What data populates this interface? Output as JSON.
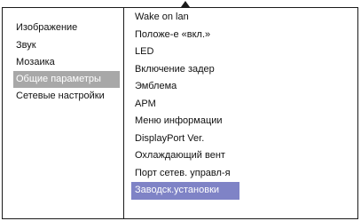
{
  "left_menu": {
    "items": [
      {
        "label": "Изображение"
      },
      {
        "label": "Звук"
      },
      {
        "label": "Мозаика"
      },
      {
        "label": "Общие параметры"
      },
      {
        "label": "Сетевые настройки"
      }
    ],
    "selected_index": 3
  },
  "right_menu": {
    "items": [
      {
        "label": "Wake on lan"
      },
      {
        "label": "Положе-е «вкл.»"
      },
      {
        "label": "LED"
      },
      {
        "label": "Включение задер"
      },
      {
        "label": "Эмблема"
      },
      {
        "label": "APM"
      },
      {
        "label": "Меню информации"
      },
      {
        "label": "DisplayPort Ver."
      },
      {
        "label": "Охлаждающий вент"
      },
      {
        "label": "Порт сетев. управл-я"
      },
      {
        "label": "Заводск.установки"
      }
    ],
    "selected_index": 10
  },
  "colors": {
    "left_selected": "#a8a8a8",
    "right_selected": "#7f83c6"
  },
  "icons": {
    "scroll_up": "triangle-up-icon"
  }
}
